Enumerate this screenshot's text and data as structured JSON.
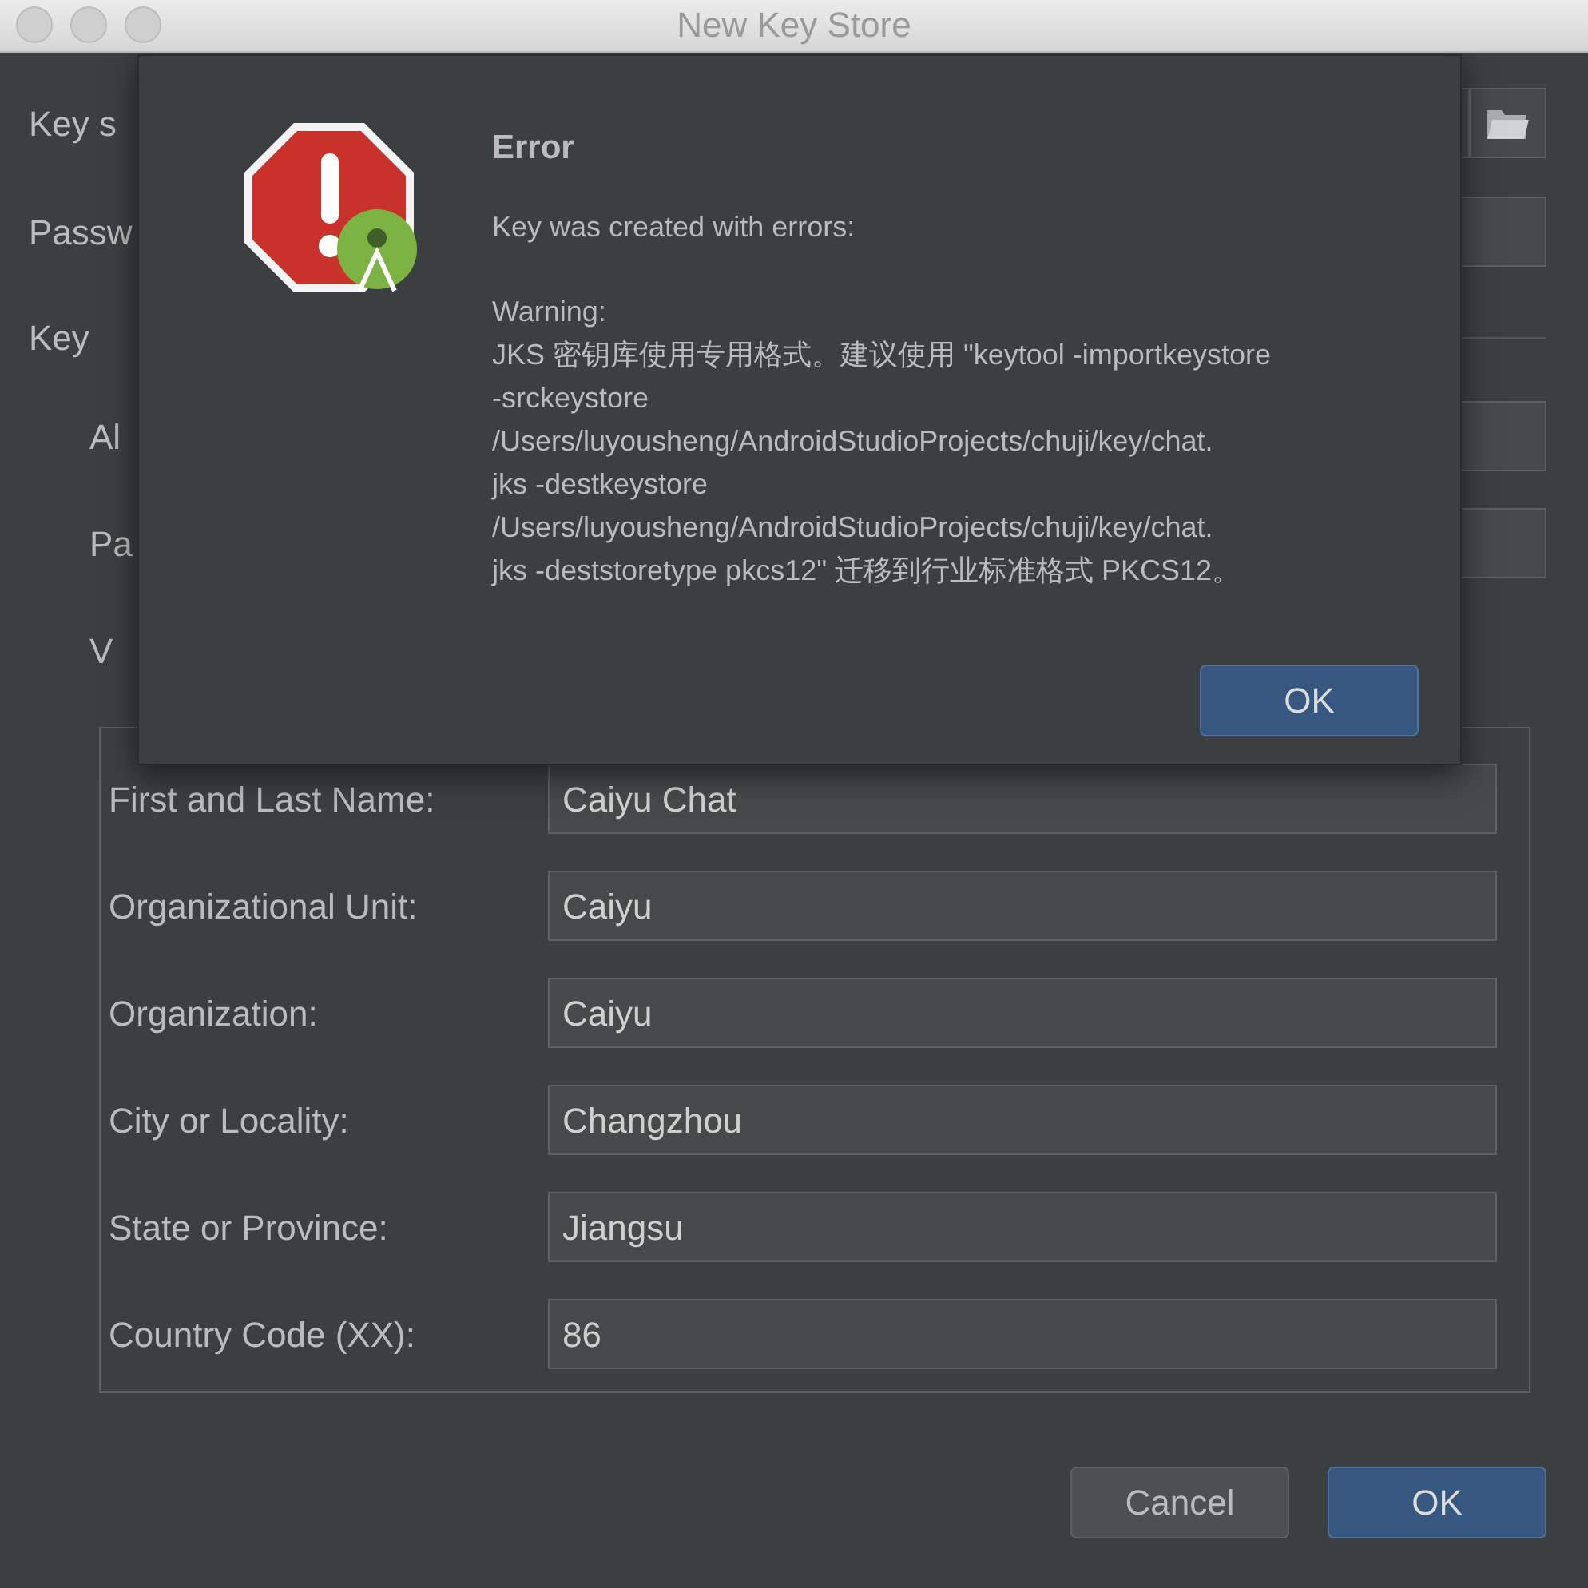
{
  "window": {
    "title": "New Key Store"
  },
  "key_store": {
    "path_label": "Key s",
    "password_label": "Passw"
  },
  "key": {
    "label": "Key",
    "alias_label": "Al",
    "password_label": "Pa",
    "validity_label": "V"
  },
  "certificate": {
    "fields": [
      {
        "label": "First and Last Name:",
        "value": "Caiyu Chat"
      },
      {
        "label": "Organizational Unit:",
        "value": "Caiyu"
      },
      {
        "label": "Organization:",
        "value": "Caiyu"
      },
      {
        "label": "City or Locality:",
        "value": "Changzhou"
      },
      {
        "label": "State or Province:",
        "value": "Jiangsu"
      },
      {
        "label": "Country Code (XX):",
        "value": "86"
      }
    ]
  },
  "buttons": [
    {
      "label": "Cancel",
      "default": false
    },
    {
      "label": "OK",
      "default": true
    }
  ],
  "error_dialog": {
    "title": "Error",
    "summary": "Key was created with errors:",
    "message_lines": [
      "Warning:",
      "JKS 密钥库使用专用格式。建议使用 \"keytool -importkeystore",
      "-srckeystore",
      "/Users/luyousheng/AndroidStudioProjects/chuji/key/chat.",
      "jks -destkeystore",
      "/Users/luyousheng/AndroidStudioProjects/chuji/key/chat.",
      "jks -deststoretype pkcs12\" 迁移到行业标准格式 PKCS12。"
    ],
    "button": {
      "label": "OK",
      "default": true
    }
  }
}
